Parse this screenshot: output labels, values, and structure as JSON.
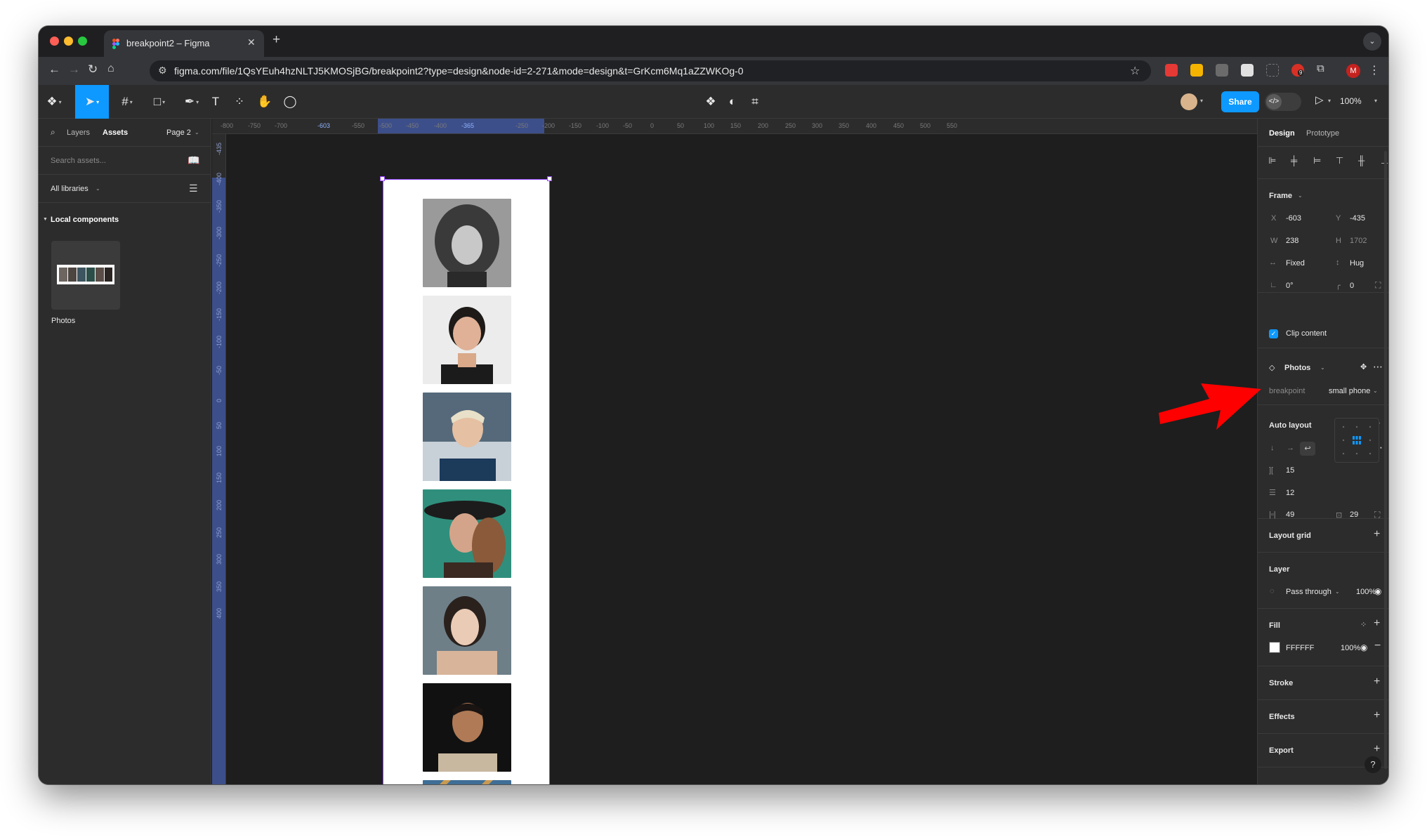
{
  "browser": {
    "tab_title": "breakpoint2 – Figma",
    "url": "figma.com/file/1QsYEuh4hzNLTJ5KMOSjBG/breakpoint2?type=design&node-id=2-271&mode=design&t=GrKcm6Mq1aZZWKOg-0",
    "profile_initial": "M",
    "extension_badge": "9"
  },
  "toolbar": {
    "share_label": "Share",
    "zoom": "100%"
  },
  "left_panel": {
    "tab_layers": "Layers",
    "tab_assets": "Assets",
    "page": "Page 2",
    "search_placeholder": "Search assets...",
    "libraries": "All libraries",
    "section": "Local components",
    "component_name": "Photos"
  },
  "ruler": {
    "top_ticks": [
      "-800",
      "-750",
      "-700",
      "-603",
      "-550",
      "-500",
      "-450",
      "-400",
      "-365",
      "-250",
      "-200",
      "-150",
      "-100",
      "-50",
      "0",
      "50",
      "100",
      "150",
      "200",
      "250",
      "300",
      "350",
      "400",
      "450",
      "500",
      "550"
    ],
    "left_ticks": [
      "-435",
      "-400",
      "-350",
      "-300",
      "-250",
      "-200",
      "-150",
      "-100",
      "-50",
      "0",
      "50",
      "100",
      "150",
      "200",
      "250",
      "300",
      "350",
      "400"
    ]
  },
  "right_panel": {
    "tab_design": "Design",
    "tab_prototype": "Prototype",
    "frame": {
      "title": "Frame",
      "x_label": "X",
      "x": "-603",
      "y_label": "Y",
      "y": "-435",
      "w_label": "W",
      "w": "238",
      "h_label": "H",
      "h": "1702",
      "w_mode": "Fixed",
      "h_mode": "Hug",
      "rotation": "0°",
      "radius": "0",
      "clip_label": "Clip content"
    },
    "component": {
      "name": "Photos",
      "prop_label": "breakpoint",
      "prop_value": "small phone"
    },
    "auto_layout": {
      "title": "Auto layout",
      "gap": "15",
      "row_gap": "12",
      "padding_h": "49",
      "padding_v": "29"
    },
    "layout_grid": "Layout grid",
    "layer": {
      "title": "Layer",
      "blend": "Pass through",
      "opacity": "100%"
    },
    "fill": {
      "title": "Fill",
      "hex": "FFFFFF",
      "opacity": "100%"
    },
    "stroke": "Stroke",
    "effects": "Effects",
    "export": "Export"
  },
  "colors": {
    "accent": "#0d99ff",
    "selection": "#9747ff",
    "annotation_arrow": "#ff0000"
  }
}
